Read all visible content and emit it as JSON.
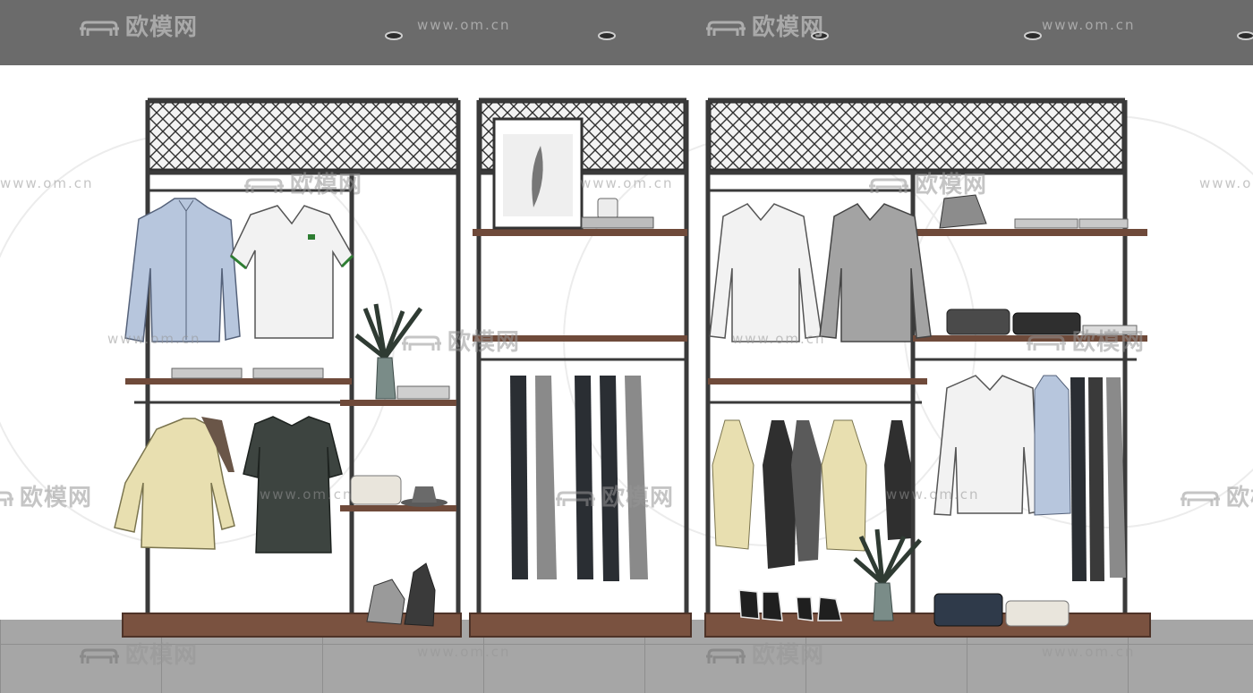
{
  "scene": {
    "watermark_text": "欧模网",
    "watermark_url": "www.om.cn",
    "colors": {
      "ceiling": "#6b6b6b",
      "wall": "#ffffff",
      "floor": "#a6a6a6",
      "frame": "#3a3a3a",
      "wood": "#6f4a3a",
      "mesh": "#2f2f2f",
      "shirt_blue": "#b7c6dd",
      "shirt_white": "#f2f2f2",
      "shirt_gray": "#a3a3a3",
      "sweater_beige": "#e8dfb0",
      "tee_dark": "#3d4440",
      "pants_dark": "#2a2e33",
      "pants_gray": "#8a8a8a",
      "plant": "#2f3b33",
      "vase": "#7a8c88"
    },
    "icons": [
      "feather-art-icon",
      "plant-icon",
      "hat-icon",
      "shoe-icon",
      "handbag-icon",
      "hanger-icon"
    ]
  }
}
